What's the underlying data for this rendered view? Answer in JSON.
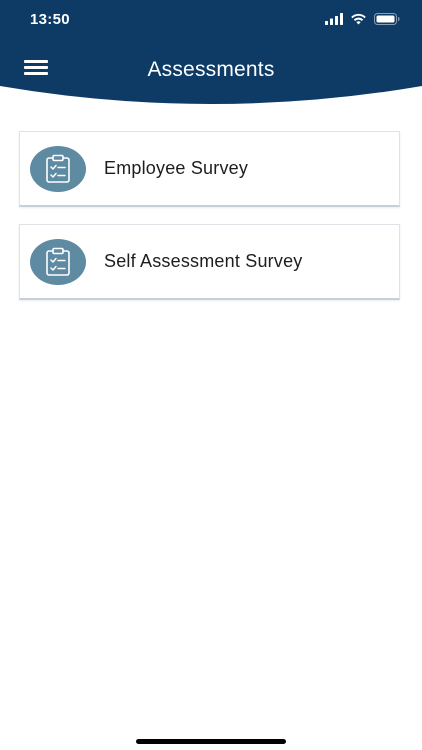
{
  "status_bar": {
    "time": "13:50",
    "icons": [
      "cellular-signal-icon",
      "wifi-icon",
      "battery-icon"
    ]
  },
  "header": {
    "title": "Assessments",
    "menu_icon": "hamburger-menu-icon",
    "background_color": "#0d3b66"
  },
  "assessments": {
    "items": [
      {
        "label": "Employee Survey",
        "icon": "clipboard-checklist-icon"
      },
      {
        "label": "Self Assessment Survey",
        "icon": "clipboard-checklist-icon"
      }
    ],
    "icon_circle_color": "#5e8aa2"
  }
}
